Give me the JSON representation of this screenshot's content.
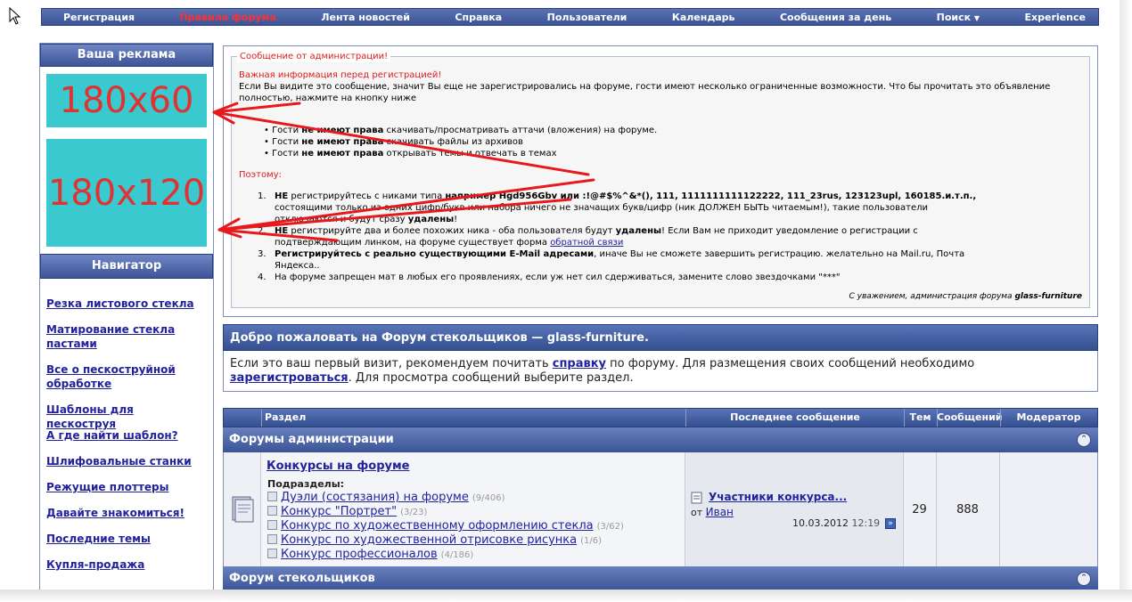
{
  "nav": {
    "items": [
      "Регистрация",
      "Правила форума",
      "Лента новостей",
      "Справка",
      "Пользователи",
      "Календарь",
      "Сообщения за день",
      "Поиск",
      "Experience"
    ]
  },
  "ads": {
    "title": "Ваша реклама",
    "box1": "180x60",
    "box2": "180x120"
  },
  "navigator": {
    "title": "Навигатор",
    "links": [
      "Резка листового стекла",
      "Матирование стекла пастами",
      "Все о пескоструйной обработке",
      "Шаблоны для пескоструя",
      "А где найти шаблон?",
      "Шлифовальные станки",
      "Режущие плоттеры",
      "Давайте знакомиться!",
      "Последние темы",
      "Купля-продажа"
    ]
  },
  "notice": {
    "legend": "Сообщение от администрации!",
    "heading": "Важная информация перед регистрацией!",
    "intro": "Если Вы видите это сообщение, значит Вы еще не зарегистрировались на форуме, гости имеют несколько ограниченные возможности. Что бы прочитать это объявление полностью, нажмите на кнопку ниже",
    "guests": [
      {
        "pre": "Гости ",
        "bold": "не имеют права",
        "post": " скачивать/просматривать аттачи (вложения) на форуме."
      },
      {
        "pre": "Гости ",
        "bold": "не имеют права",
        "post": " скачивать файлы из архивов"
      },
      {
        "pre": "Гости ",
        "bold": "не имеют права",
        "post": " открывать темы и отвечать в темах"
      }
    ],
    "therefore": "Поэтому:",
    "rules": {
      "r1a_bold": "НЕ",
      "r1a": " регистрируйтесь с никами типа ",
      "r1a_bold2": "например Hgd956Gbv или :!@#$%^&*(), 111, 1111111111122222, 111_23rus, 123123upl, 160185.и.т.п.,",
      "r1b": "состоящими только из одних цифр/букв или набора ничего не значащих букв/цифр (ник ДОЛЖЕН БЫТЬ читаемым!), такие пользователи",
      "r1c": "отключаются и будут сразу ",
      "r1c_bold": "удалены",
      "r1c_end": "!",
      "r2a_bold": "НЕ",
      "r2a": " регистрируйте два и более похожих ника - оба пользователя будут ",
      "r2a_bold2": "удалены",
      "r2a_end": "! Если Вам не приходит уведомление о регистрации с",
      "r2b": "подтверждающим линком, на форуме существует форма ",
      "r2b_link": "обратной связи",
      "r3a_bold": "Регистрируйтесь с реально существующими E-Mail адресами",
      "r3a": ", иначе Вы не сможете завершить регистрацию. желательно на Mail.ru, Почта",
      "r3b": "Яндекса..",
      "r4": "На форуме запрещен мат в любых его проявлениях, если уж нет сил сдерживаться, замените слово звездочками \"***\""
    },
    "numbers": [
      "1.",
      "2.",
      "3.",
      "4."
    ],
    "signature": "С уважением, администрация форума ",
    "signature_bold": "glass-furniture"
  },
  "welcome": {
    "title": "Добро пожаловать на Форум стекольщиков — glass-furniture.",
    "p1": "Если это ваш первый визит, рекомендуем почитать ",
    "link1": "справку",
    "p2": " по форуму. Для размещения своих сообщений необходимо",
    "link2": "зарегистроваться",
    "p3": ". Для просмотра сообщений выберите раздел."
  },
  "table": {
    "headers": [
      "Раздел",
      "Последнее сообщение",
      "Тем",
      "Сообщений",
      "Модератор"
    ],
    "category1": "Форумы администрации",
    "category2": "Форум стекольщиков",
    "forum": {
      "title": "Конкурсы на форуме",
      "subforums_label": "Подразделы:",
      "subforums": [
        {
          "name": "Дуэли (состязания) на форуме",
          "count": "(9/406)"
        },
        {
          "name": "Конкурс \"Портрет\"",
          "count": "(3/23)"
        },
        {
          "name": "Конкурс по художественному оформлению стекла",
          "count": "(3/62)"
        },
        {
          "name": "Конкурс по художественной отрисовке рисунка",
          "count": "(1/6)"
        },
        {
          "name": "Конкурс профессионалов",
          "count": "(4/186)"
        }
      ],
      "last_title": "Участники конкурса...",
      "last_from": "от ",
      "last_user": "Иван",
      "last_date": "10.03.2012",
      "last_time": "12:19",
      "topics": "29",
      "posts": "888"
    }
  },
  "annotation": {
    "color": "#e8191d"
  }
}
